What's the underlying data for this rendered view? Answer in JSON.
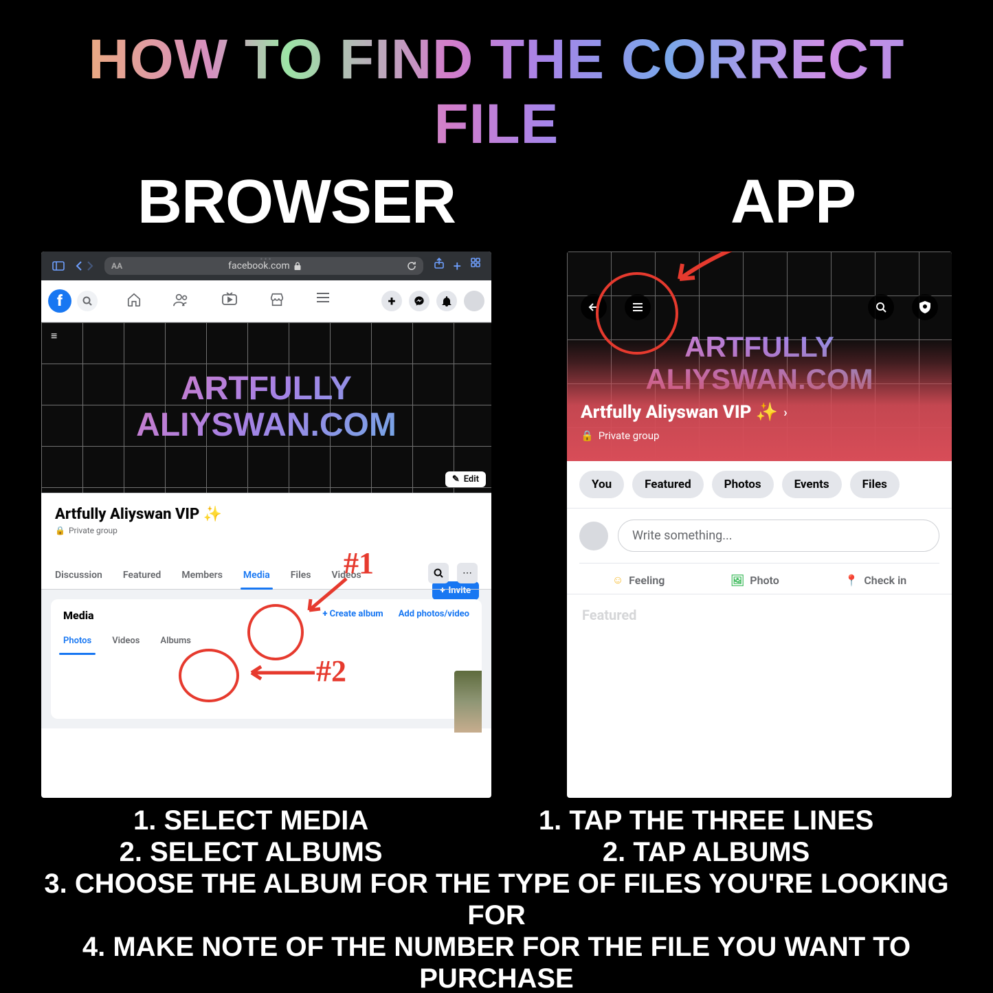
{
  "title": "HOW TO FIND THE CORRECT FILE",
  "subheaders": {
    "browser": "BROWSER",
    "app": "APP"
  },
  "browser": {
    "urlbar": {
      "aa": "AA",
      "domain": "facebook.com"
    },
    "fb_logo": "f",
    "cover_line1": "ARTFULLY",
    "cover_line2": "ALIYSWAN.COM",
    "edit": "Edit",
    "group_title": "Artfully Aliyswan VIP ✨",
    "group_privacy": "Private group",
    "invite": "Invite",
    "tabs": {
      "discussion": "Discussion",
      "featured": "Featured",
      "members": "Members",
      "media": "Media",
      "files": "Files",
      "videos": "Videos"
    },
    "media": {
      "heading": "Media",
      "create_album": "Create album",
      "add_photos": "Add photos/video",
      "subtabs": {
        "photos": "Photos",
        "videos": "Videos",
        "albums": "Albums"
      }
    },
    "annot": {
      "one": "#1",
      "two": "#2"
    }
  },
  "app": {
    "cover_line1": "ARTFULLY",
    "cover_line2": "ALIYSWAN.COM",
    "group_title": "Artfully Aliyswan VIP ✨",
    "group_privacy": "Private group",
    "pills": {
      "you": "You",
      "featured": "Featured",
      "photos": "Photos",
      "events": "Events",
      "files": "Files"
    },
    "post_placeholder": "Write something...",
    "actions": {
      "feeling": "Feeling",
      "photo": "Photo",
      "checkin": "Check in"
    },
    "featured": "Featured"
  },
  "instructions": {
    "browser": {
      "l1": "1. SELECT MEDIA",
      "l2": "2. SELECT ALBUMS"
    },
    "app": {
      "l1": "1. TAP THE THREE LINES",
      "l2": "2. TAP ALBUMS"
    },
    "l3": "3. CHOOSE THE ALBUM FOR THE TYPE OF FILES YOU'RE LOOKING FOR",
    "l4": "4. MAKE NOTE OF THE NUMBER FOR THE FILE YOU WANT TO PURCHASE"
  }
}
